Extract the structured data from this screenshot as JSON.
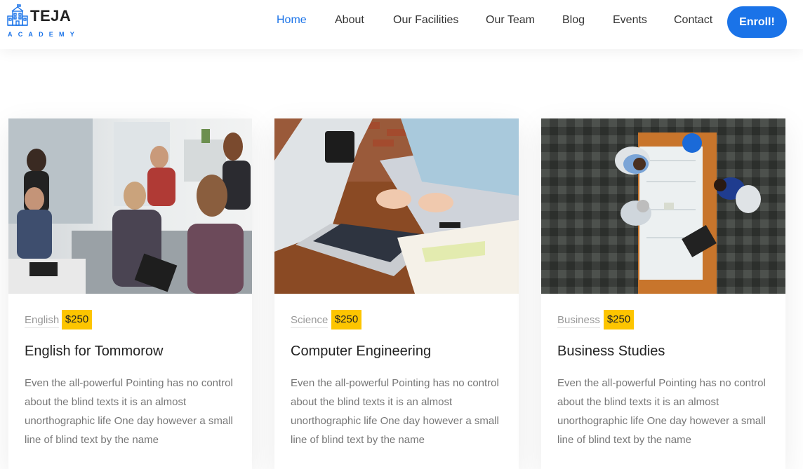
{
  "brand": {
    "name": "TEJA",
    "subtitle": "ACADEMY",
    "accent": "#1a73e8"
  },
  "nav": {
    "items": [
      {
        "label": "Home",
        "active": true
      },
      {
        "label": "About",
        "active": false
      },
      {
        "label": "Our Facilities",
        "active": false
      },
      {
        "label": "Our Team",
        "active": false
      },
      {
        "label": "Blog",
        "active": false
      },
      {
        "label": "Events",
        "active": false
      },
      {
        "label": "Contact",
        "active": false
      }
    ],
    "cta_label": "Enroll!"
  },
  "courses": [
    {
      "category": "English",
      "price": "$250",
      "title": "English for Tommorow",
      "description": "Even the all-powerful Pointing has no control about the blind texts it is an almost unorthographic life One day however a small line of blind text by the name",
      "image": "students-discussion-photo"
    },
    {
      "category": "Science",
      "price": "$250",
      "title": "Computer Engineering",
      "description": "Even the all-powerful Pointing has no control about the blind texts it is an almost unorthographic life One day however a small line of blind text by the name",
      "image": "laptop-typing-photo"
    },
    {
      "category": "Business",
      "price": "$250",
      "title": "Business Studies",
      "description": "Even the all-powerful Pointing has no control about the blind texts it is an almost unorthographic life One day however a small line of blind text by the name",
      "image": "team-meeting-overhead-photo"
    }
  ],
  "colors": {
    "price_badge": "#fdc500",
    "nav_active": "#1a73e8",
    "button": "#1a73e8"
  }
}
